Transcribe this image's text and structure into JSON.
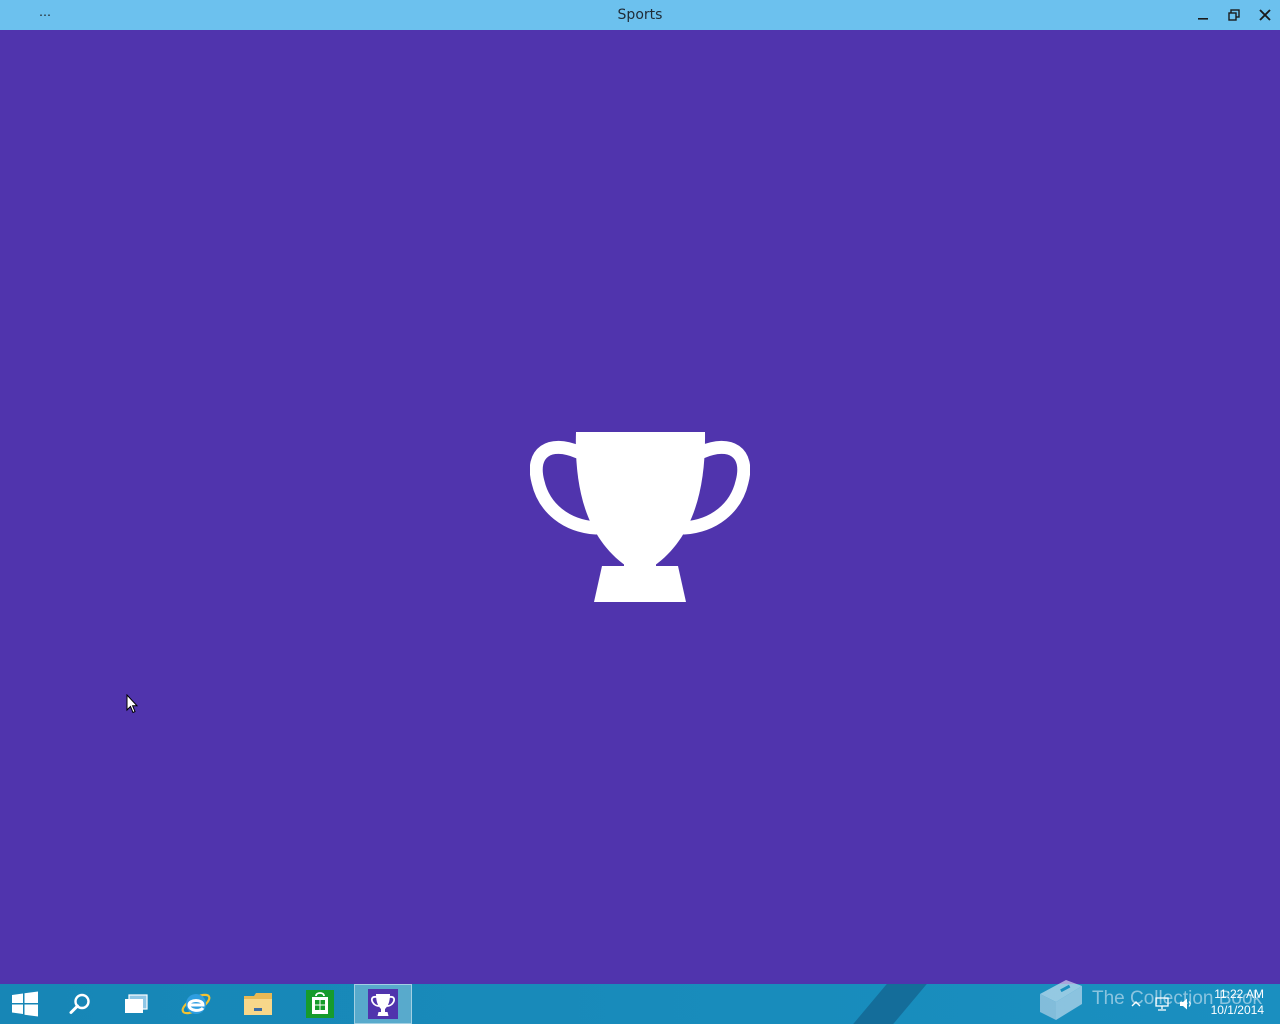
{
  "window": {
    "title": "Sports",
    "menu_label": "…"
  },
  "splash": {
    "icon": "trophy-icon",
    "background_color": "#5034ad"
  },
  "taskbar": {
    "items": [
      {
        "name": "start",
        "icon": "windows-logo-icon"
      },
      {
        "name": "search",
        "icon": "search-icon"
      },
      {
        "name": "task-view",
        "icon": "task-view-icon"
      },
      {
        "name": "internet-explorer",
        "icon": "internet-explorer-icon"
      },
      {
        "name": "file-explorer",
        "icon": "folder-icon"
      },
      {
        "name": "store",
        "icon": "store-icon"
      },
      {
        "name": "sports",
        "icon": "trophy-icon",
        "active": true
      }
    ],
    "watermark": "The Collection Book",
    "clock": {
      "time": "11:22 AM",
      "date": "10/1/2014"
    }
  }
}
